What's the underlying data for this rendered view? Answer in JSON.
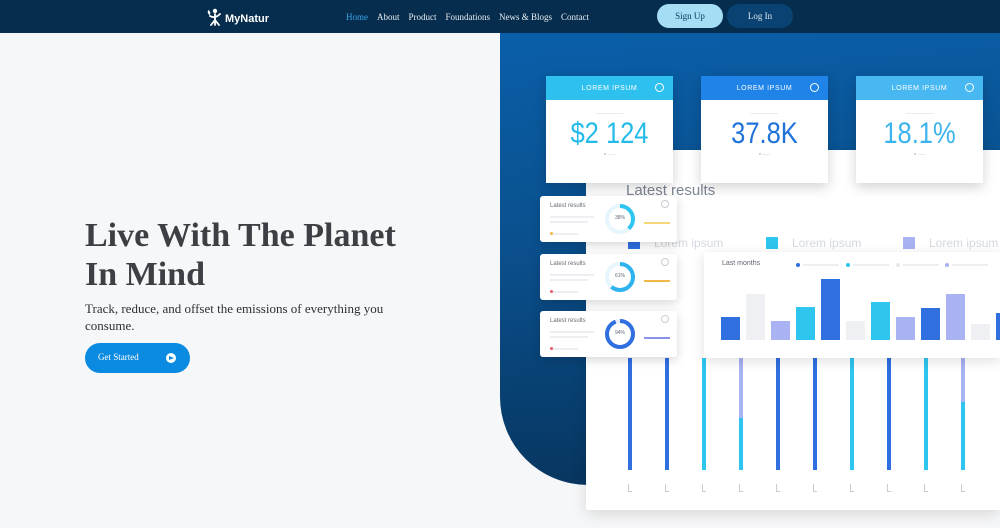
{
  "colors": {
    "nav_bg": "#062d4d",
    "accent": "#0a8ae0",
    "active_link": "#38a6e8",
    "signup_bg": "#a5ddf4",
    "login_bg": "#0a4373",
    "panel_blue": "#0a5fa9",
    "series_blue": "#2f6fe0",
    "series_cyan": "#2ec5ef",
    "series_lavender": "#a9b2f2"
  },
  "brand": {
    "name": "MyNatur",
    "icon": "leaf-person-icon"
  },
  "nav": {
    "links": [
      {
        "label": "Home",
        "active": true
      },
      {
        "label": "About",
        "active": false
      },
      {
        "label": "Product",
        "active": false
      },
      {
        "label": "Foundations",
        "active": false
      },
      {
        "label": "News & Blogs",
        "active": false
      },
      {
        "label": "Contact",
        "active": false
      }
    ],
    "signup_label": "Sign Up",
    "login_label": "Log In"
  },
  "hero": {
    "title": "Live With The Planet In Mind",
    "subtitle": "Track, reduce, and offset the emissions of everything you consume.",
    "cta_label": "Get Started",
    "cta_icon": "arrow-right-circle-icon"
  },
  "dashboard": {
    "board_title": "Latest results",
    "legend": [
      "Lorem ipsum",
      "Lorem ipsum",
      "Lorem ipsum"
    ],
    "stat_cards": [
      {
        "header": "LOREM IPSUM",
        "value": "$2 124"
      },
      {
        "header": "LOREM IPSUM",
        "value": "37.8K"
      },
      {
        "header": "LOREM IPSUM",
        "value": "18.1%"
      }
    ],
    "mini_cards": [
      {
        "title": "Latest results",
        "percent": "38%",
        "progress": 0.38
      },
      {
        "title": "Latest results",
        "percent": "61%",
        "progress": 0.61
      },
      {
        "title": "Latest results",
        "percent": "94%",
        "progress": 0.94
      }
    ],
    "chart_title": "Last months"
  }
}
